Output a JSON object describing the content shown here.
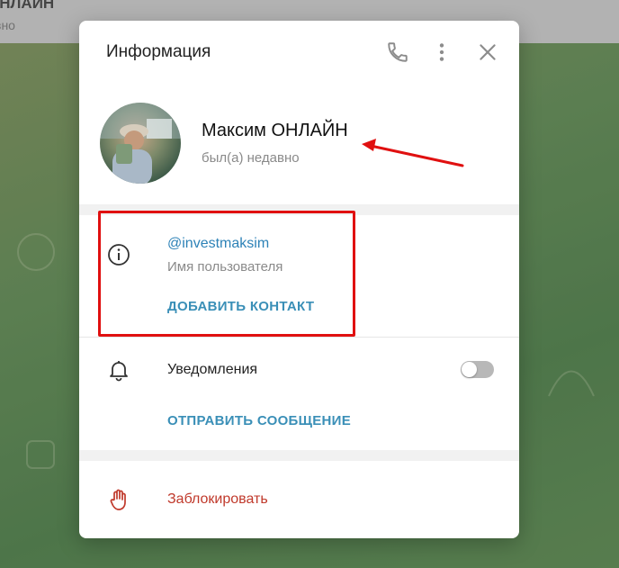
{
  "background": {
    "chat_title": "ОНЛАЙН",
    "chat_subtitle": "вно"
  },
  "dialog": {
    "title": "Информация",
    "header_icons": [
      "phone-icon",
      "more-vertical-icon",
      "close-icon"
    ],
    "profile": {
      "name": "Максим ОНЛАЙН",
      "status": "был(а) недавно"
    },
    "info": {
      "username": "@investmaksim",
      "username_label": "Имя пользователя",
      "add_contact": "ДОБАВИТЬ КОНТАКТ"
    },
    "notifications": {
      "label": "Уведомления",
      "enabled": false,
      "send_message": "ОТПРАВИТЬ СООБЩЕНИЕ"
    },
    "block": {
      "label": "Заблокировать"
    }
  },
  "colors": {
    "accent": "#2d82b7",
    "danger": "#c0392b",
    "annotation": "#e01010"
  }
}
